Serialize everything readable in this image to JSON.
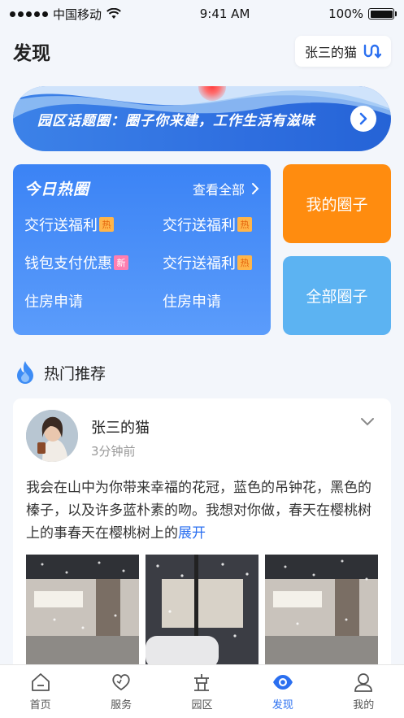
{
  "status_bar": {
    "carrier": "中国移动",
    "time": "9:41 AM",
    "battery": "100%",
    "battery_level": 1.0
  },
  "header": {
    "title": "发现",
    "user_chip": "张三的猫"
  },
  "banner": {
    "text": "园区话题圈：圈子你来建，工作生活有滋味"
  },
  "hot_circles": {
    "title": "今日热圈",
    "view_all": "查看全部",
    "items": [
      {
        "label": "交行送福利",
        "tag": "热",
        "tag_type": "hot"
      },
      {
        "label": "交行送福利",
        "tag": "热",
        "tag_type": "hot"
      },
      {
        "label": "钱包支付优惠",
        "tag": "新",
        "tag_type": "new"
      },
      {
        "label": "交行送福利",
        "tag": "热",
        "tag_type": "hot"
      },
      {
        "label": "住房申请",
        "tag": "",
        "tag_type": ""
      },
      {
        "label": "住房申请",
        "tag": "",
        "tag_type": ""
      }
    ]
  },
  "side_buttons": {
    "my_circles": "我的圈子",
    "all_circles": "全部圈子"
  },
  "section": {
    "title": "热门推荐"
  },
  "post": {
    "author": "张三的猫",
    "time": "3分钟前",
    "text": "我会在山中为你带来幸福的花冠，蓝色的吊钟花，黑色的榛子，以及许多蓝朴素的吻。我想对你做，春天在樱桃树上的事春天在樱桃树上的",
    "expand": "展开"
  },
  "tabs": [
    {
      "label": "首页",
      "icon": "home-icon",
      "active": false
    },
    {
      "label": "服务",
      "icon": "heart-icon",
      "active": false
    },
    {
      "label": "园区",
      "icon": "park-icon",
      "active": false
    },
    {
      "label": "发现",
      "icon": "eye-icon",
      "active": true
    },
    {
      "label": "我的",
      "icon": "user-icon",
      "active": false
    }
  ],
  "colors": {
    "accent": "#2a6ff0",
    "orange": "#ff8c0f",
    "sky": "#5cb3f2"
  }
}
